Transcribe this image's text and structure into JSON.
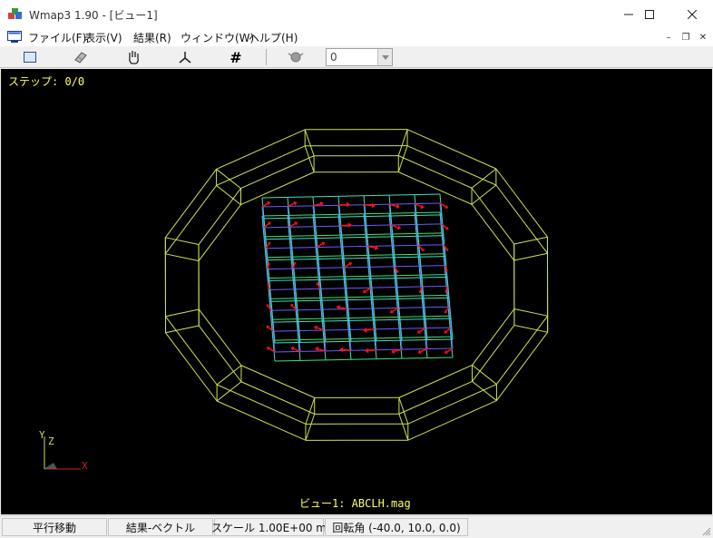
{
  "window": {
    "title": "Wmap3 1.90 - [ビュー1]",
    "minimize_glyph": "—",
    "maximize_glyph": "☐",
    "close_glyph": "✕"
  },
  "menu": {
    "items": [
      "ファイル(F)",
      "表示(V)",
      "結果(R)",
      "ウィンドウ(W)",
      "ヘルプ(H)"
    ],
    "mdi_minimize": "–",
    "mdi_restore": "❐",
    "mdi_close": "✕"
  },
  "toolbar": {
    "tools": [
      "fit-view-icon",
      "eraser-icon",
      "hand-pan-icon",
      "axes-icon",
      "grid-hash-icon",
      "rotate-icon"
    ],
    "grid_glyph": "#",
    "combo_value": "0"
  },
  "viewport": {
    "step_label": "ステップ: 0/0",
    "view_label": "ビュー1: ABCLH.mag",
    "axis_x": "X",
    "axis_y": "Y",
    "axis_z": "Z",
    "background": "#000000",
    "ring_color": "#c8e650",
    "mesh_color": "#40e0c0",
    "inner_mesh_color": "#6a5cff",
    "vector_color": "#ff1010"
  },
  "status": {
    "mode": "平行移動",
    "result": "結果-ベクトル",
    "scale": "スケール 1.00E+00 m",
    "rotation": "回転角 (-40.0, 10.0, 0.0)"
  }
}
